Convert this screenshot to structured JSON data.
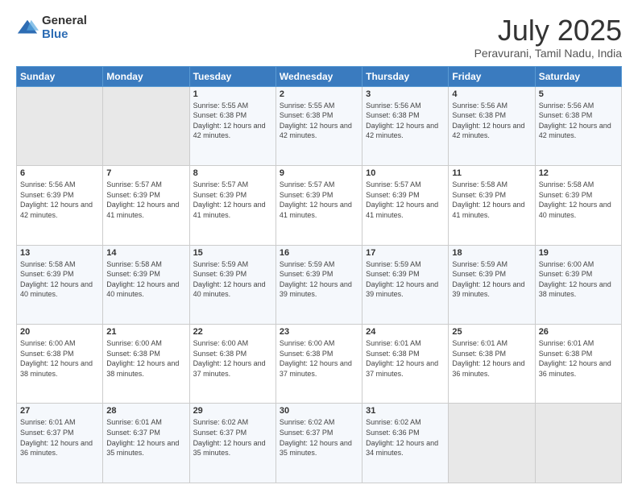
{
  "logo": {
    "general": "General",
    "blue": "Blue"
  },
  "header": {
    "title": "July 2025",
    "subtitle": "Peravurani, Tamil Nadu, India"
  },
  "weekdays": [
    "Sunday",
    "Monday",
    "Tuesday",
    "Wednesday",
    "Thursday",
    "Friday",
    "Saturday"
  ],
  "weeks": [
    [
      {
        "day": "",
        "sunrise": "",
        "sunset": "",
        "daylight": ""
      },
      {
        "day": "",
        "sunrise": "",
        "sunset": "",
        "daylight": ""
      },
      {
        "day": "1",
        "sunrise": "Sunrise: 5:55 AM",
        "sunset": "Sunset: 6:38 PM",
        "daylight": "Daylight: 12 hours and 42 minutes."
      },
      {
        "day": "2",
        "sunrise": "Sunrise: 5:55 AM",
        "sunset": "Sunset: 6:38 PM",
        "daylight": "Daylight: 12 hours and 42 minutes."
      },
      {
        "day": "3",
        "sunrise": "Sunrise: 5:56 AM",
        "sunset": "Sunset: 6:38 PM",
        "daylight": "Daylight: 12 hours and 42 minutes."
      },
      {
        "day": "4",
        "sunrise": "Sunrise: 5:56 AM",
        "sunset": "Sunset: 6:38 PM",
        "daylight": "Daylight: 12 hours and 42 minutes."
      },
      {
        "day": "5",
        "sunrise": "Sunrise: 5:56 AM",
        "sunset": "Sunset: 6:38 PM",
        "daylight": "Daylight: 12 hours and 42 minutes."
      }
    ],
    [
      {
        "day": "6",
        "sunrise": "Sunrise: 5:56 AM",
        "sunset": "Sunset: 6:39 PM",
        "daylight": "Daylight: 12 hours and 42 minutes."
      },
      {
        "day": "7",
        "sunrise": "Sunrise: 5:57 AM",
        "sunset": "Sunset: 6:39 PM",
        "daylight": "Daylight: 12 hours and 41 minutes."
      },
      {
        "day": "8",
        "sunrise": "Sunrise: 5:57 AM",
        "sunset": "Sunset: 6:39 PM",
        "daylight": "Daylight: 12 hours and 41 minutes."
      },
      {
        "day": "9",
        "sunrise": "Sunrise: 5:57 AM",
        "sunset": "Sunset: 6:39 PM",
        "daylight": "Daylight: 12 hours and 41 minutes."
      },
      {
        "day": "10",
        "sunrise": "Sunrise: 5:57 AM",
        "sunset": "Sunset: 6:39 PM",
        "daylight": "Daylight: 12 hours and 41 minutes."
      },
      {
        "day": "11",
        "sunrise": "Sunrise: 5:58 AM",
        "sunset": "Sunset: 6:39 PM",
        "daylight": "Daylight: 12 hours and 41 minutes."
      },
      {
        "day": "12",
        "sunrise": "Sunrise: 5:58 AM",
        "sunset": "Sunset: 6:39 PM",
        "daylight": "Daylight: 12 hours and 40 minutes."
      }
    ],
    [
      {
        "day": "13",
        "sunrise": "Sunrise: 5:58 AM",
        "sunset": "Sunset: 6:39 PM",
        "daylight": "Daylight: 12 hours and 40 minutes."
      },
      {
        "day": "14",
        "sunrise": "Sunrise: 5:58 AM",
        "sunset": "Sunset: 6:39 PM",
        "daylight": "Daylight: 12 hours and 40 minutes."
      },
      {
        "day": "15",
        "sunrise": "Sunrise: 5:59 AM",
        "sunset": "Sunset: 6:39 PM",
        "daylight": "Daylight: 12 hours and 40 minutes."
      },
      {
        "day": "16",
        "sunrise": "Sunrise: 5:59 AM",
        "sunset": "Sunset: 6:39 PM",
        "daylight": "Daylight: 12 hours and 39 minutes."
      },
      {
        "day": "17",
        "sunrise": "Sunrise: 5:59 AM",
        "sunset": "Sunset: 6:39 PM",
        "daylight": "Daylight: 12 hours and 39 minutes."
      },
      {
        "day": "18",
        "sunrise": "Sunrise: 5:59 AM",
        "sunset": "Sunset: 6:39 PM",
        "daylight": "Daylight: 12 hours and 39 minutes."
      },
      {
        "day": "19",
        "sunrise": "Sunrise: 6:00 AM",
        "sunset": "Sunset: 6:39 PM",
        "daylight": "Daylight: 12 hours and 38 minutes."
      }
    ],
    [
      {
        "day": "20",
        "sunrise": "Sunrise: 6:00 AM",
        "sunset": "Sunset: 6:38 PM",
        "daylight": "Daylight: 12 hours and 38 minutes."
      },
      {
        "day": "21",
        "sunrise": "Sunrise: 6:00 AM",
        "sunset": "Sunset: 6:38 PM",
        "daylight": "Daylight: 12 hours and 38 minutes."
      },
      {
        "day": "22",
        "sunrise": "Sunrise: 6:00 AM",
        "sunset": "Sunset: 6:38 PM",
        "daylight": "Daylight: 12 hours and 37 minutes."
      },
      {
        "day": "23",
        "sunrise": "Sunrise: 6:00 AM",
        "sunset": "Sunset: 6:38 PM",
        "daylight": "Daylight: 12 hours and 37 minutes."
      },
      {
        "day": "24",
        "sunrise": "Sunrise: 6:01 AM",
        "sunset": "Sunset: 6:38 PM",
        "daylight": "Daylight: 12 hours and 37 minutes."
      },
      {
        "day": "25",
        "sunrise": "Sunrise: 6:01 AM",
        "sunset": "Sunset: 6:38 PM",
        "daylight": "Daylight: 12 hours and 36 minutes."
      },
      {
        "day": "26",
        "sunrise": "Sunrise: 6:01 AM",
        "sunset": "Sunset: 6:38 PM",
        "daylight": "Daylight: 12 hours and 36 minutes."
      }
    ],
    [
      {
        "day": "27",
        "sunrise": "Sunrise: 6:01 AM",
        "sunset": "Sunset: 6:37 PM",
        "daylight": "Daylight: 12 hours and 36 minutes."
      },
      {
        "day": "28",
        "sunrise": "Sunrise: 6:01 AM",
        "sunset": "Sunset: 6:37 PM",
        "daylight": "Daylight: 12 hours and 35 minutes."
      },
      {
        "day": "29",
        "sunrise": "Sunrise: 6:02 AM",
        "sunset": "Sunset: 6:37 PM",
        "daylight": "Daylight: 12 hours and 35 minutes."
      },
      {
        "day": "30",
        "sunrise": "Sunrise: 6:02 AM",
        "sunset": "Sunset: 6:37 PM",
        "daylight": "Daylight: 12 hours and 35 minutes."
      },
      {
        "day": "31",
        "sunrise": "Sunrise: 6:02 AM",
        "sunset": "Sunset: 6:36 PM",
        "daylight": "Daylight: 12 hours and 34 minutes."
      },
      {
        "day": "",
        "sunrise": "",
        "sunset": "",
        "daylight": ""
      },
      {
        "day": "",
        "sunrise": "",
        "sunset": "",
        "daylight": ""
      }
    ]
  ]
}
